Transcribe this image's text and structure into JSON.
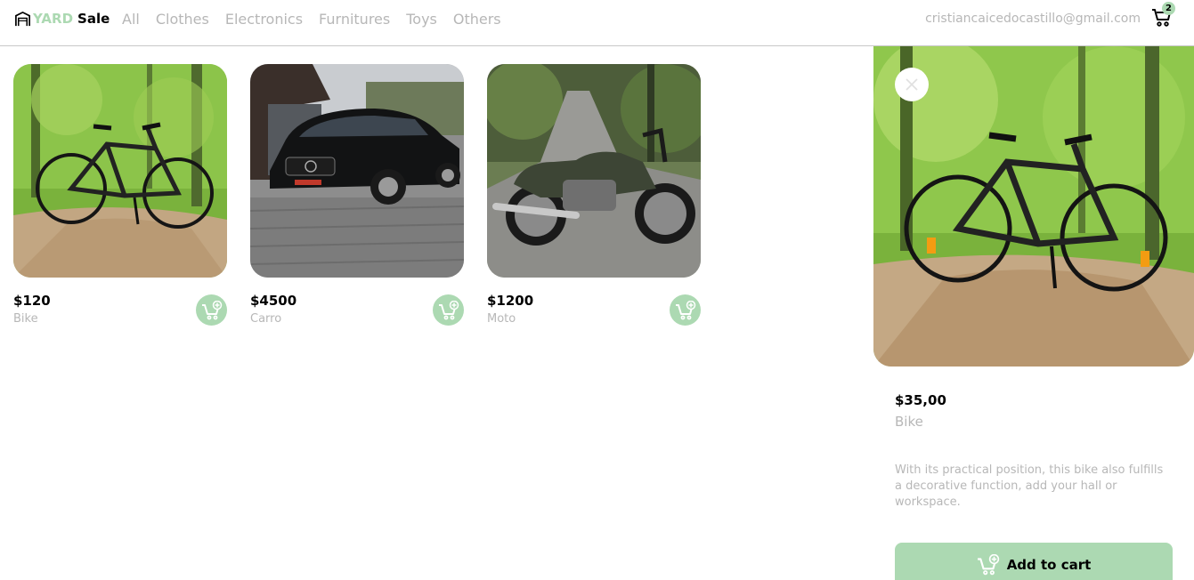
{
  "navbar": {
    "logo_yard": "YARD",
    "logo_sale": "Sale",
    "categories": [
      "All",
      "Clothes",
      "Electronics",
      "Furnitures",
      "Toys",
      "Others"
    ],
    "email": "cristiancaicedocastillo@gmail.com",
    "cart_count": "2"
  },
  "products": [
    {
      "price": "$120",
      "name": "Bike",
      "image": "bicycle-on-forest-path"
    },
    {
      "price": "$4500",
      "name": "Carro",
      "image": "black-mercedes-wagon"
    },
    {
      "price": "$1200",
      "name": "Moto",
      "image": "cafe-racer-motorcycle-on-road"
    }
  ],
  "detail": {
    "price": "$35,00",
    "name": "Bike",
    "description": "With its practical position, this bike also fulfills a decorative function, add your hall or workspace.",
    "add_button_label": "Add to cart",
    "image": "bicycle-on-forest-path"
  },
  "colors": {
    "accent": "#acd9b2",
    "muted_text": "#b7b7b7",
    "border": "#c8c8c8"
  },
  "icons": {
    "logo": "garage-icon",
    "cart": "shopping-cart-icon",
    "add_to_cart": "cart-plus-icon",
    "close": "close-icon"
  }
}
